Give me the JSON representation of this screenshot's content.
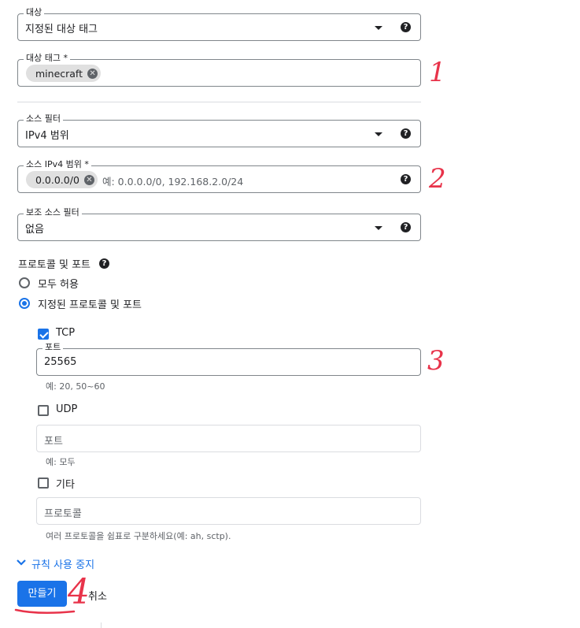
{
  "target": {
    "label": "대상",
    "value": "지정된 대상 태그"
  },
  "target_tags": {
    "label": "대상 태그 *",
    "chip": "minecraft"
  },
  "source_filter": {
    "label": "소스 필터",
    "value": "IPv4 범위"
  },
  "source_ipv4": {
    "label": "소스 IPv4 범위 *",
    "chip": "0.0.0.0/0",
    "placeholder": "예: 0.0.0.0/0, 192.168.2.0/24"
  },
  "secondary_filter": {
    "label": "보조 소스 필터",
    "value": "없음"
  },
  "protocols": {
    "title": "프로토콜 및 포트",
    "allow_all": "모두 허용",
    "specified": "지정된 프로토콜 및 포트",
    "tcp": {
      "label": "TCP",
      "checked": true,
      "port_label": "포트",
      "port_value": "25565",
      "hint": "예: 20, 50~60"
    },
    "udp": {
      "label": "UDP",
      "checked": false,
      "port_placeholder": "포트",
      "hint": "예: 모두"
    },
    "other": {
      "label": "기타",
      "checked": false,
      "protocol_placeholder": "프로토콜",
      "hint": "여러 프로토콜을 쉼표로 구분하세요(예: ah, sctp)."
    }
  },
  "disable_rule": "규칙 사용 중지",
  "buttons": {
    "create": "만들기",
    "cancel": "취소"
  },
  "annotations": [
    "1",
    "2",
    "3",
    "4"
  ],
  "colors": {
    "accent": "#1a73e8",
    "annotation": "#e8334a"
  }
}
